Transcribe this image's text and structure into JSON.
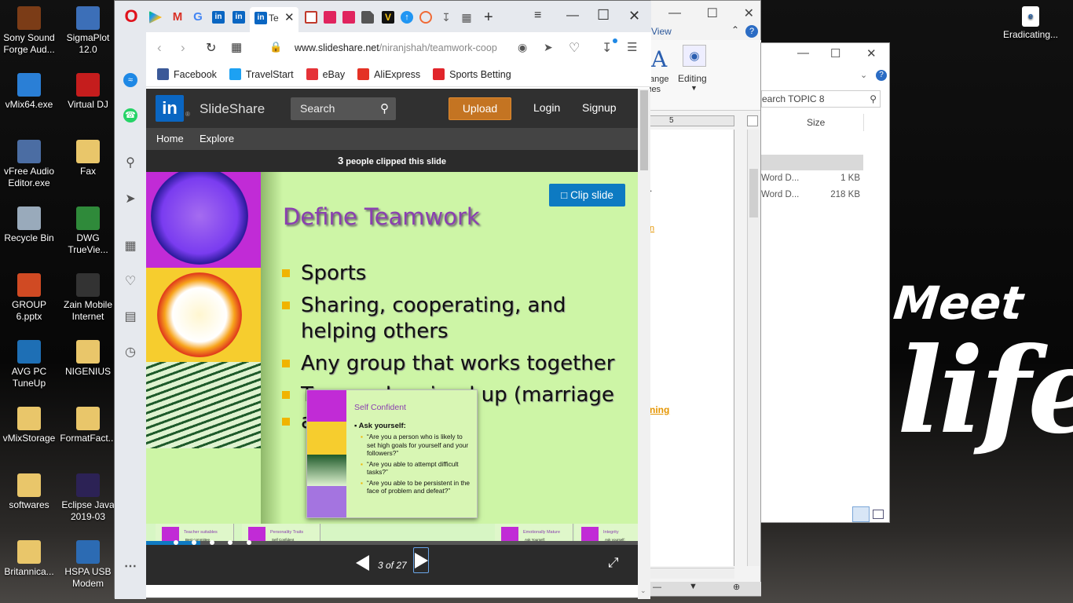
{
  "desktop": {
    "icons_left": [
      {
        "label": "Sony Sound Forge Aud...",
        "color": "#7b3c17"
      },
      {
        "label": "vMix64.exe",
        "color": "#2a7fd6"
      },
      {
        "label": "vFree Audio Editor.exe",
        "color": "#4b6da3"
      },
      {
        "label": "Recycle Bin",
        "color": "#9ab"
      },
      {
        "label": "GROUP 6.pptx",
        "color": "#d04a23"
      },
      {
        "label": "AVG PC TuneUp",
        "color": "#1e6fb5"
      },
      {
        "label": "vMixStorage",
        "color": "#e9c66a"
      },
      {
        "label": "softwares",
        "color": "#e9c66a"
      },
      {
        "label": "Britannica...",
        "color": "#e9c66a"
      }
    ],
    "icons_right": [
      {
        "label": "SigmaPlot 12.0",
        "color": "#3c6fb8"
      },
      {
        "label": "Virtual DJ",
        "color": "#c51d1d"
      },
      {
        "label": "Fax",
        "color": "#e9c66a"
      },
      {
        "label": "DWG TrueVie...",
        "color": "#2f8a3a"
      },
      {
        "label": "Zain Mobile Internet",
        "color": "#333"
      },
      {
        "label": "NIGENIUS",
        "color": "#e9c66a"
      },
      {
        "label": "FormatFact...",
        "color": "#e9c66a"
      },
      {
        "label": "Eclipse Java 2019-03",
        "color": "#2c2255"
      },
      {
        "label": "HSPA USB Modem",
        "color": "#2c6bb3"
      }
    ],
    "top_right_icon": "Eradicating...",
    "wallpaper_meet": "Meet",
    "wallpaper_life": "life"
  },
  "word": {
    "view_tab": "View",
    "editing_label": "Editing",
    "change_styles": "ange\nles",
    "ruler_mark": "5",
    "doc_link_1": "n",
    "doc_link_2": "ning"
  },
  "explorer": {
    "search_placeholder": "earch TOPIC 8",
    "col_size": "Size",
    "rows": [
      {
        "type": "Word D...",
        "size": "1 KB"
      },
      {
        "type": "Word D...",
        "size": "218 KB"
      }
    ]
  },
  "browser": {
    "tab_title": "Te",
    "url_host": "www.slideshare.net",
    "url_path": "/niranjshah/teamwork-coop",
    "bookmarks": [
      {
        "label": "Facebook",
        "color": "#3b5998"
      },
      {
        "label": "TravelStart",
        "color": "#1da1f2"
      },
      {
        "label": "eBay",
        "color": "#e53238"
      },
      {
        "label": "AliExpress",
        "color": "#e43225"
      },
      {
        "label": "Sports Betting",
        "color": "#e1252b"
      }
    ]
  },
  "slideshare": {
    "logo_text": "SlideShare",
    "search_label": "Search",
    "upload_label": "Upload",
    "login_label": "Login",
    "signup_label": "Signup",
    "nav_home": "Home",
    "nav_explore": "Explore",
    "clip_count": "3",
    "clip_text": "people clipped this slide",
    "clip_button": "Clip slide",
    "slide_title": "Define Teamwork",
    "bullets": [
      "Sports",
      "Sharing, cooperating, and helping others",
      "Any group that works together",
      "T          d      i    d up (marriage",
      "a"
    ],
    "popup": {
      "title": "Self Confident",
      "heading": "Ask yourself:",
      "items": [
        "“Are you a person who is likely to set high goals for yourself and your followers?”",
        "“Are you able to attempt difficult tasks?”",
        "“Are you able to be persistent in the face of problem and defeat?”"
      ]
    },
    "thumbs": [
      {
        "title": "Teacher suitables",
        "lines": "Best committee\nBest team player\nBest lesson plans\nBest personality\nBest discipline\nCleanest room\nBest cross curricular activity\netc."
      },
      {
        "title": "Personality Traits",
        "lines": "Self Confident\nStress Tolerant\nEmotionally Mature\nIntegrity"
      },
      {
        "title": "Emotionally Mature",
        "lines": "Ask Yourself:\nAre you a person that tends to have accurate awareness of your strengths and weaknesses?"
      },
      {
        "title": "Integrity",
        "lines": "Ask yourself:\nAre you a person consistent with words and deeds?"
      }
    ],
    "pager_text": "3 of 27",
    "progress_fraction": 0.111
  }
}
